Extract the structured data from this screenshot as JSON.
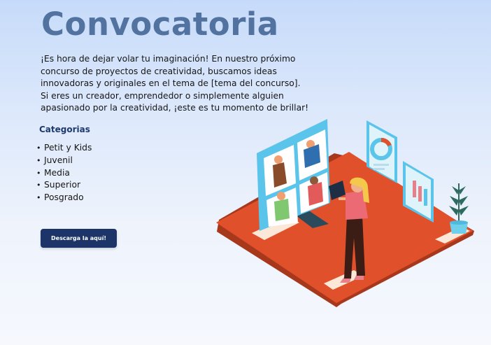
{
  "header": {
    "title": "Convocatoria",
    "intro": "¡Es hora de dejar volar tu imaginación! En nuestro próximo concurso de proyectos de creatividad, buscamos ideas innovadoras y originales en el tema de [tema del concurso]. Si eres un creador, emprendedor o simplemente alguien apasionado por la creatividad, ¡este es tu momento de brillar!"
  },
  "categories": {
    "title": "Categorias",
    "items": [
      {
        "label": "Petit y Kids"
      },
      {
        "label": "Juvenil"
      },
      {
        "label": "Media"
      },
      {
        "label": "Superior"
      },
      {
        "label": "Posgrado"
      }
    ]
  },
  "download": {
    "label": "Descarga la aquí!"
  },
  "colors": {
    "title": "#52729f",
    "button": "#1d3468",
    "category_heading": "#1e3a6d",
    "floor": "#e0512b",
    "screen": "#5bc4ea"
  },
  "illustration": {
    "icons": [
      "video-call-screen",
      "donut-chart-panel",
      "bar-chart-panel",
      "potted-plant",
      "person-with-tablet"
    ]
  }
}
